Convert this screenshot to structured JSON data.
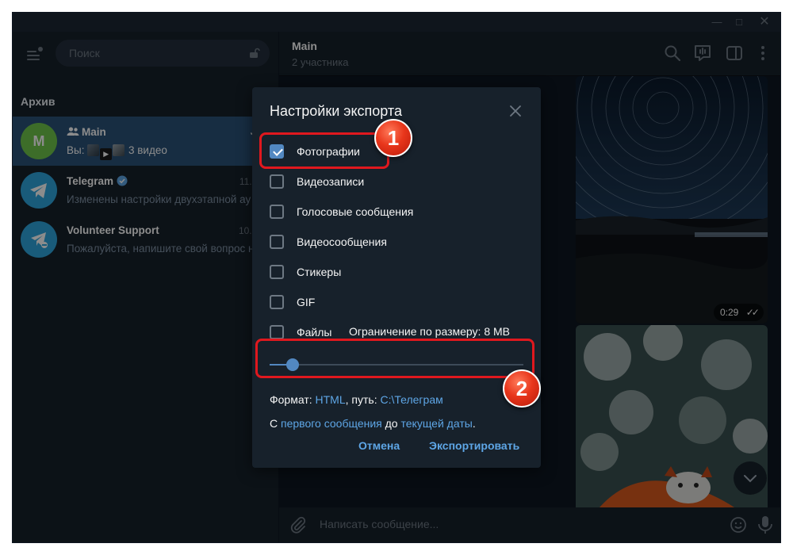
{
  "sidebar": {
    "search_placeholder": "Поиск",
    "section_title": "Архив",
    "chats": [
      {
        "avatar_letter": "M",
        "avatar_color": "#6fc74b",
        "name": "Main",
        "time": "1",
        "preview_prefix": "Вы:",
        "preview": "3 видео",
        "active": true
      },
      {
        "name": "Telegram",
        "time": "11.08.2",
        "preview": "Изменены настройки двухэтапной ау",
        "avatar_color": "#2ea6de",
        "verified": true
      },
      {
        "name": "Volunteer Support",
        "time": "10.08.2",
        "preview": "Пожалуйста, напишите свой вопрос н",
        "avatar_color": "#2ea6de"
      }
    ]
  },
  "header": {
    "title": "Main",
    "subtitle": "2 участника"
  },
  "media": {
    "video_duration": "0:29"
  },
  "composer": {
    "placeholder": "Написать сообщение..."
  },
  "dialog": {
    "title": "Настройки экспорта",
    "options": [
      {
        "label": "Фотографии",
        "checked": true
      },
      {
        "label": "Видеозаписи",
        "checked": false
      },
      {
        "label": "Голосовые сообщения",
        "checked": false
      },
      {
        "label": "Видеосообщения",
        "checked": false
      },
      {
        "label": "Стикеры",
        "checked": false
      },
      {
        "label": "GIF",
        "checked": false
      },
      {
        "label": "Файлы",
        "checked": false
      }
    ],
    "size_limit": "Ограничение по размеру: 8 MB",
    "size_slider_level": 0.09,
    "format_label": "Формат:",
    "format_value": "HTML",
    "path_label": ", путь:",
    "path_value": "C:\\Телеграм",
    "range_prefix": "С",
    "range_from": "первого сообщения",
    "range_mid": "до",
    "range_to": "текущей даты",
    "range_suffix": ".",
    "cancel": "Отмена",
    "export": "Экспортировать"
  },
  "annotations": {
    "step1": "1",
    "step2": "2"
  },
  "colors": {
    "accent": "#5288c1",
    "link": "#5ea6e6",
    "highlight": "#e0181e",
    "sidebar_bg": "#17212b",
    "chat_bg": "#0e1621"
  }
}
